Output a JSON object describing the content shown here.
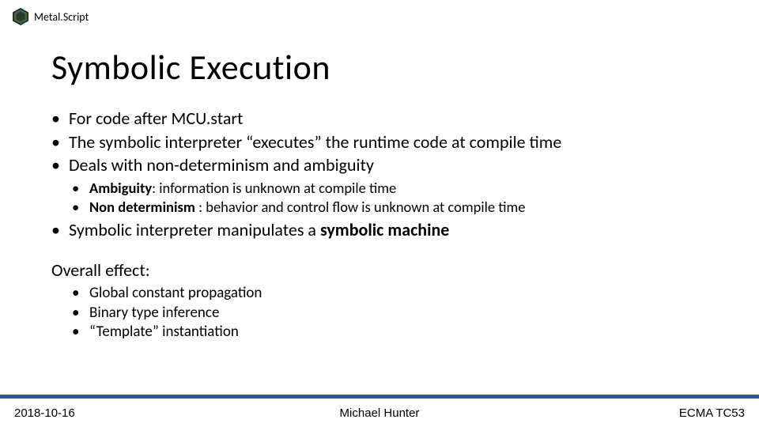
{
  "header": {
    "brand": "Metal.Script"
  },
  "title": "Symbolic Execution",
  "bullets": {
    "b1": "For code after MCU.start",
    "b2": "The symbolic interpreter “executes” the runtime code at compile time",
    "b3": "Deals with non-determinism and ambiguity",
    "b3_sub": {
      "s1_term": "Ambiguity",
      "s1_rest": ": information is unknown at compile time",
      "s2_term": "Non determinism",
      "s2_rest": " : behavior and control flow is unknown at compile time"
    },
    "b4_pre": "Symbolic interpreter manipulates a ",
    "b4_strong": "symbolic machine"
  },
  "overall_label": "Overall effect:",
  "overall": {
    "o1": "Global constant propagation",
    "o2": "Binary type inference",
    "o3": "“Template” instantiation"
  },
  "footer": {
    "date": "2018-10-16",
    "author": "Michael Hunter",
    "venue": "ECMA TC53"
  }
}
